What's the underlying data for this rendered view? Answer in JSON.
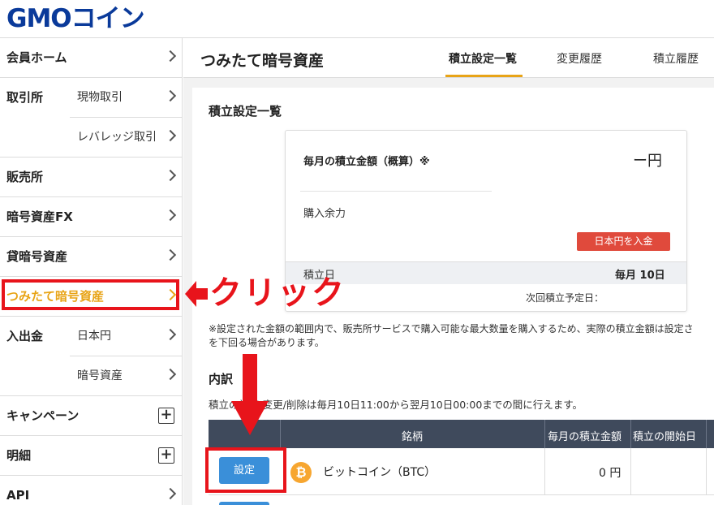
{
  "logo": {
    "text": "GMO",
    "accent": "コイン"
  },
  "sidebar": {
    "items": [
      {
        "label": "会員ホーム",
        "sub": ""
      },
      {
        "label": "取引所",
        "sub": "現物取引"
      },
      {
        "label": "",
        "sub": "レバレッジ取引"
      },
      {
        "label": "販売所",
        "sub": ""
      },
      {
        "label": "暗号資産FX",
        "sub": ""
      },
      {
        "label": "貸暗号資産",
        "sub": ""
      },
      {
        "label": "つみたて暗号資産",
        "sub": ""
      },
      {
        "label": "入出金",
        "sub": "日本円"
      },
      {
        "label": "",
        "sub": "暗号資産"
      },
      {
        "label": "キャンペーン",
        "sub": ""
      },
      {
        "label": "明細",
        "sub": ""
      },
      {
        "label": "API",
        "sub": ""
      }
    ],
    "plus_symbol": "+"
  },
  "header": {
    "title": "つみたて暗号資産",
    "tabs": [
      {
        "label": "積立設定一覧"
      },
      {
        "label": "変更履歴"
      },
      {
        "label": "積立履歴"
      }
    ]
  },
  "main": {
    "section_title": "積立設定一覧",
    "card": {
      "amount_label": "毎月の積立金額（概算）※",
      "amount_value": "ー円",
      "balance_label": "購入余力",
      "deposit_button": "日本円を入金",
      "date_label": "積立日",
      "date_value": "毎月 10日",
      "next_label": "次回積立予定日："
    },
    "notice_line1": "※設定された金額の範囲内で、販売所サービスで購入可能な最大数量を購入するため、実際の積立金額は設定さ",
    "notice_line2": "を下回る場合があります。",
    "breakdown_title": "内訳",
    "breakdown_note": "積立の設定/変更/削除は毎月10日11:00から翌月10日00:00までの間に行えます。",
    "table": {
      "headers": [
        "銘柄",
        "毎月の積立金額",
        "積立の開始日"
      ],
      "rows": [
        {
          "button": "設定",
          "coin_symbol": "₿",
          "coin": "ビットコイン（BTC）",
          "amount": "0 円"
        }
      ]
    }
  },
  "annotation": {
    "click_text": "クリック"
  },
  "colors": {
    "brand": "#0a3a9a",
    "accent": "#e8a417",
    "highlight": "#e8141b",
    "button_blue": "#3a8fd9",
    "deposit_red": "#e04a3c"
  }
}
